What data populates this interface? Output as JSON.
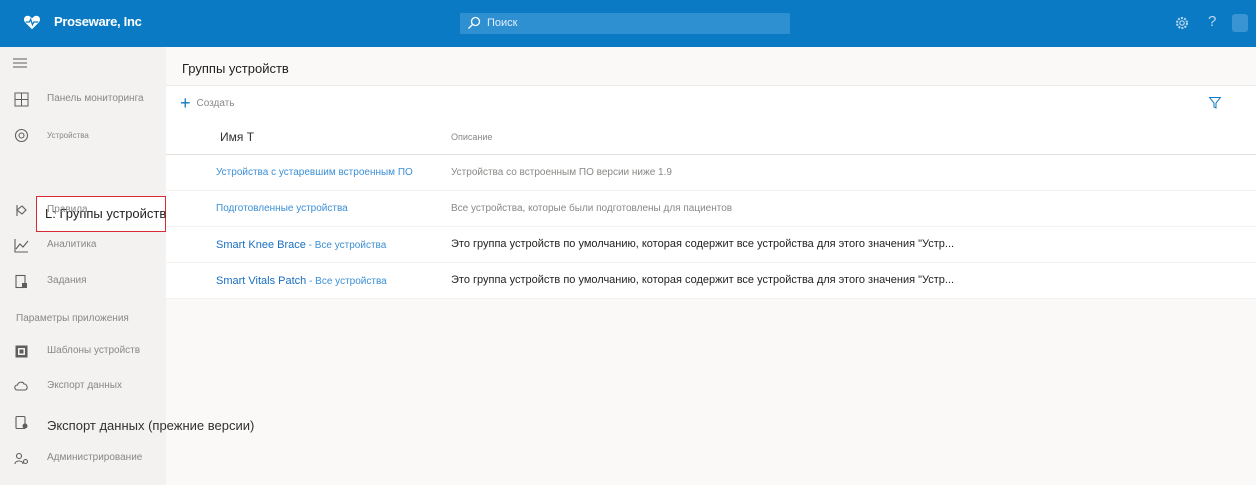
{
  "app": {
    "brand_name": "Proseware, Inc",
    "search_placeholder": "Поиск",
    "help_label": "?"
  },
  "colors": {
    "header_bg": "#0a7ac4",
    "link": "#3b8fd6",
    "selection_outline": "#d92a33"
  },
  "sidebar": {
    "items": [
      {
        "label": "Панель мониторинга",
        "icon": "dashboard-icon"
      },
      {
        "label": "Устройства",
        "icon": "devices-icon"
      },
      {
        "label": "L: Группы устройств",
        "icon": "device-groups-icon"
      },
      {
        "label": "Правила",
        "icon": "rules-icon"
      },
      {
        "label": "Аналитика",
        "icon": "analytics-icon"
      },
      {
        "label": "Задания",
        "icon": "jobs-icon"
      }
    ],
    "section_title": "Параметры приложения",
    "settings_items": [
      {
        "label": "Шаблоны устройств",
        "icon": "device-templates-icon"
      },
      {
        "label": "Экспорт данных",
        "icon": "data-export-icon"
      },
      {
        "label": "Экспорт данных (прежние версии)",
        "icon": "legacy-export-icon"
      },
      {
        "label": "Администрирование",
        "icon": "administration-icon"
      }
    ]
  },
  "main": {
    "title": "Группы устройств",
    "create_label": "Создать",
    "columns": {
      "name": "Имя Т",
      "description": "Описание"
    },
    "rows": [
      {
        "name": "Устройства с устаревшим встроенным ПО",
        "scope": "",
        "description": "Устройства со встроенным ПО версии ниже 1.9"
      },
      {
        "name": "Подготовленные устройства",
        "scope": "",
        "description": "Все устройства, которые были подготовлены для пациентов"
      },
      {
        "name": "Smart Knee Brace",
        "scope": "Все устройства",
        "description": "Это группа устройств по умолчанию, которая содержит все устройства для этого значения \"Устр..."
      },
      {
        "name": "Smart Vitals Patch",
        "scope": "Все устройства",
        "description": "Это группа устройств по умолчанию, которая содержит все устройства для этого значения \"Устр..."
      }
    ]
  }
}
